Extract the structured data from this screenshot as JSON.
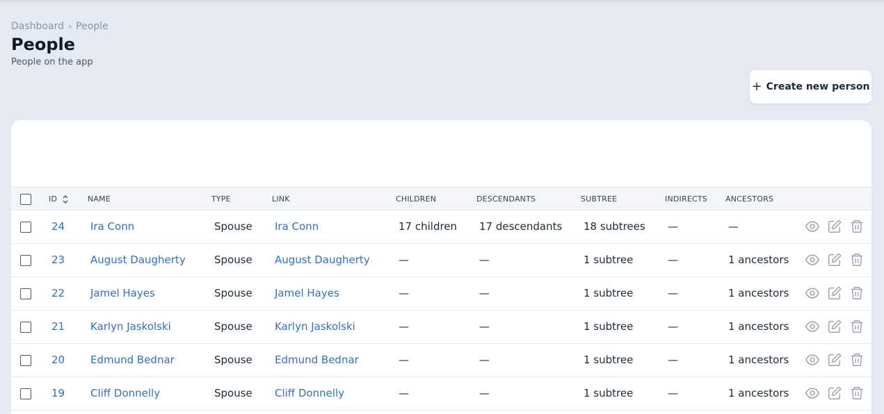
{
  "breadcrumb": {
    "home": "Dashboard",
    "separator": "›",
    "current": "People"
  },
  "header": {
    "title": "People",
    "subtitle": "People on the app"
  },
  "create_button": {
    "icon": "plus-icon",
    "label": "Create new person"
  },
  "table": {
    "columns": {
      "id": "ID",
      "name": "NAME",
      "type": "TYPE",
      "link": "LINK",
      "children": "CHILDREN",
      "descendants": "DESCENDANTS",
      "subtree": "SUBTREE",
      "indirects": "INDIRECTS",
      "ancestors": "ANCESTORS"
    },
    "rows": [
      {
        "id": "24",
        "name": "Ira Conn",
        "type": "Spouse",
        "link": "Ira Conn",
        "children": "17 children",
        "descendants": "17 descendants",
        "subtree": "18 subtrees",
        "indirects": "—",
        "ancestors": "—"
      },
      {
        "id": "23",
        "name": "August Daugherty",
        "type": "Spouse",
        "link": "August Daugherty",
        "children": "—",
        "descendants": "—",
        "subtree": "1 subtree",
        "indirects": "—",
        "ancestors": "1 ancestors"
      },
      {
        "id": "22",
        "name": "Jamel Hayes",
        "type": "Spouse",
        "link": "Jamel Hayes",
        "children": "—",
        "descendants": "—",
        "subtree": "1 subtree",
        "indirects": "—",
        "ancestors": "1 ancestors"
      },
      {
        "id": "21",
        "name": "Karlyn Jaskolski",
        "type": "Spouse",
        "link": "Karlyn Jaskolski",
        "children": "—",
        "descendants": "—",
        "subtree": "1 subtree",
        "indirects": "—",
        "ancestors": "1 ancestors"
      },
      {
        "id": "20",
        "name": "Edmund Bednar",
        "type": "Spouse",
        "link": "Edmund Bednar",
        "children": "—",
        "descendants": "—",
        "subtree": "1 subtree",
        "indirects": "—",
        "ancestors": "1 ancestors"
      },
      {
        "id": "19",
        "name": "Cliff Donnelly",
        "type": "Spouse",
        "link": "Cliff Donnelly",
        "children": "—",
        "descendants": "—",
        "subtree": "1 subtree",
        "indirects": "—",
        "ancestors": "1 ancestors"
      }
    ],
    "row_actions": [
      "eye-icon",
      "edit-icon",
      "trash-icon"
    ]
  },
  "colors": {
    "background": "#e5e9f2",
    "link": "#2f6fca",
    "icon": "#9ca3af",
    "header_bg": "#f3f5f9"
  }
}
